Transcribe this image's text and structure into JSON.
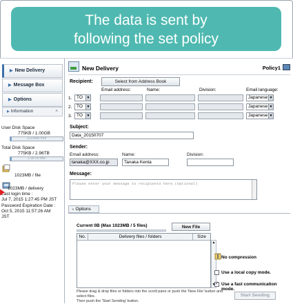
{
  "banner": {
    "line1": "The data is sent by",
    "line2": "following the set policy"
  },
  "sidebar": {
    "items": [
      {
        "label": "New Delivery"
      },
      {
        "label": "Message Box"
      },
      {
        "label": "Options"
      }
    ],
    "info_label": "Information",
    "user_disk_space_label": "User Disk Space",
    "user_disk_space_value": "775KB / 1.00GB",
    "user_disk_free": "1023MB free",
    "user_disk_fraction": 0.001,
    "total_disk_space_label": "Total Disk Space",
    "total_disk_space_value": "775KB / 2.96TB",
    "total_disk_free": "2.96TB free",
    "total_disk_fraction": 0.001,
    "per_file": "1023MB / file",
    "per_delivery": "1023MB / delivery",
    "last_login_label": "Last login time :",
    "last_login_value": "Jul 7, 2015 1:27:45 PM JST",
    "pw_expiration_label": "Password Expiration Date :",
    "pw_expiration_value": "Oct 5, 2015 11:57:26 AM",
    "pw_expiration_tz": "JST"
  },
  "main": {
    "title": "New Delivery",
    "policy": "Policy1",
    "recipient_label": "Recipient:",
    "address_book_button": "Select from Address Book",
    "columns": {
      "email": "Email address:",
      "name": "Name:",
      "division": "Division:",
      "language": "Email language:"
    },
    "recipients": [
      {
        "num": "1.",
        "type": "TO",
        "language": "Japanese"
      },
      {
        "num": "2.",
        "type": "TO",
        "language": "Japanese"
      },
      {
        "num": "3.",
        "type": "TO",
        "language": "Japanese"
      }
    ],
    "subject_label": "Subject:",
    "subject_value": "Data_20150707",
    "sender_label": "Sender:",
    "sender_columns": {
      "email": "Email address:",
      "name": "Name:",
      "division": "Division:"
    },
    "sender_email": "tanaka@XXX.co.jp",
    "sender_name": "Tanaka Kenta",
    "sender_division": "",
    "message_label": "Message:",
    "message_placeholder": "Please enter your message to recipients here.(optional)",
    "options_tab": "Options",
    "current_label": "Current 0B (Max 1023MB / 5 files)",
    "new_file_button": "New File",
    "table_headers": {
      "no": "No.",
      "files": "Delivery files / folders",
      "size": "Size"
    },
    "no_compression": "No compression",
    "local_copy": "Use a local copy mode.",
    "fast_mode": "Use a fast communication mode.",
    "local_copy_checked": false,
    "fast_mode_checked": true,
    "hint_line1": "Please drag & drop files or folders into the scroll pane or push the 'New File' button and select files.",
    "hint_line2": "Then push the 'Start Sending' button.",
    "start_button": "Start Sending"
  },
  "colors": {
    "banner": "#4fb9b1",
    "arrow": "#e02020"
  }
}
